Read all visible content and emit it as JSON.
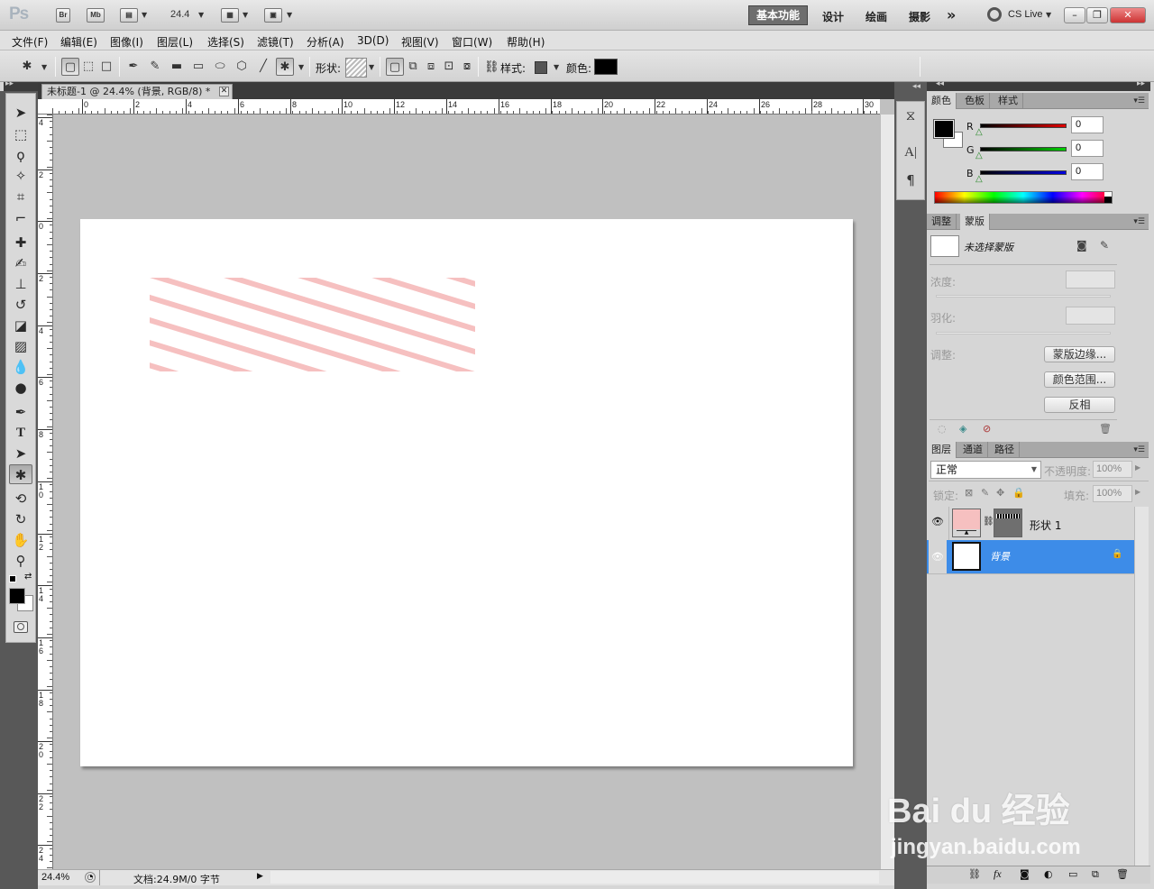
{
  "app": {
    "logo": "Ps",
    "bridge_label": "Br",
    "minibridge_label": "Mb",
    "zoom_value": "24.4",
    "workspaces": [
      "基本功能",
      "设计",
      "绘画",
      "摄影"
    ],
    "more_label": "»",
    "cs_live": "CS Live"
  },
  "menu": [
    "文件(F)",
    "编辑(E)",
    "图像(I)",
    "图层(L)",
    "选择(S)",
    "滤镜(T)",
    "分析(A)",
    "3D(D)",
    "视图(V)",
    "窗口(W)",
    "帮助(H)"
  ],
  "options": {
    "shape_label": "形状:",
    "style_label": "样式:",
    "color_label": "颜色:",
    "color_value": "#000000"
  },
  "document": {
    "tab_title": "未标题-1 @ 24.4% (背景, RGB/8) *",
    "ruler_top": [
      "0",
      "2",
      "4",
      "6",
      "8",
      "10",
      "12",
      "14",
      "16",
      "18",
      "20",
      "22",
      "24",
      "26",
      "28",
      "30"
    ],
    "ruler_left": [
      "4",
      "2",
      "0",
      "2",
      "4",
      "6",
      "8",
      "1\n0",
      "1\n2",
      "1\n4",
      "1\n6",
      "1\n8",
      "2\n0",
      "2\n2",
      "2\n4"
    ],
    "stripe_color": "#f6c0c0",
    "status_zoom": "24.4%",
    "status_doc": "文档:24.9M/0 字节"
  },
  "color_panel": {
    "tabs": [
      "颜色",
      "色板",
      "样式"
    ],
    "channels": [
      {
        "label": "R",
        "value": "0",
        "color": "#d40000"
      },
      {
        "label": "G",
        "value": "0",
        "color": "#00b000"
      },
      {
        "label": "B",
        "value": "0",
        "color": "#0000c8"
      }
    ],
    "foreground": "#000000",
    "background": "#ffffff"
  },
  "mask_panel": {
    "tabs": [
      "调整",
      "蒙版"
    ],
    "title": "未选择蒙版",
    "density_label": "浓度:",
    "feather_label": "羽化:",
    "refine_label": "调整:",
    "buttons": [
      "蒙版边缘...",
      "颜色范围...",
      "反相"
    ]
  },
  "layers_panel": {
    "tabs": [
      "图层",
      "通道",
      "路径"
    ],
    "blend_mode": "正常",
    "opacity_label": "不透明度:",
    "opacity_value": "100%",
    "lock_label": "锁定:",
    "fill_label": "填充:",
    "fill_value": "100%",
    "layers": [
      {
        "name": "形状 1",
        "thumb_color": "#f6c0c0",
        "selected": false
      },
      {
        "name": "背景",
        "thumb_color": "#ffffff",
        "selected": true
      }
    ]
  },
  "watermark": {
    "brand": "Bai du 经验",
    "url": "jingyan.baidu.com"
  }
}
